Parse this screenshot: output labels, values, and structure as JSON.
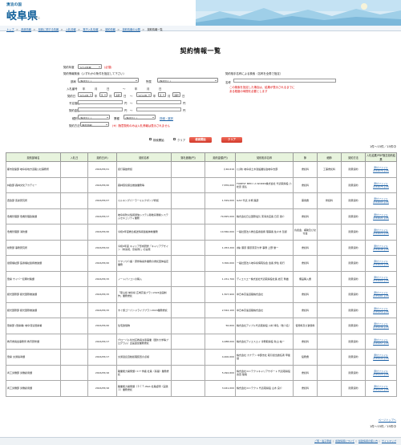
{
  "header": {
    "logo_small": "清流の国",
    "logo_main": "岐阜県",
    "logo_mark": "ぎふ"
  },
  "breadcrumbs": [
    {
      "label": "トップ"
    },
    {
      "label": "県政情報"
    },
    {
      "label": "県政に関する情報"
    },
    {
      "label": "入札情報"
    },
    {
      "label": "電子入札情報"
    },
    {
      "label": "契約情報"
    },
    {
      "label": "契約情報の公開"
    }
  ],
  "breadcrumbs_current": "契約情報一覧",
  "page_title": "契約情報一覧",
  "form": {
    "fiscal_year_label": "契約年度",
    "fiscal_year_value": "2024年度",
    "fiscal_year_req": "(必須)",
    "conditions_label": "契約情報検索（いずれかの条件を指定して下さい）",
    "dept_label": "部局",
    "dept_value": "(指定なし)",
    "bureau_label": "所属",
    "bureau_value": "(指定なし)",
    "contract_no_label": "入札番号",
    "from_label": "年",
    "month_label": "月",
    "day_label": "日",
    "date_label": "契約日",
    "date_from": [
      "2024年",
      "5",
      "14"
    ],
    "date_to": [
      "2024年",
      "5",
      "28"
    ],
    "tilde": "〜",
    "amount_label": "予定価格",
    "amount_unit": "円",
    "price_label": "契約金額",
    "type_label": "種別",
    "type_value": "(指定なし)",
    "business_label": "業種",
    "business_value": "(指定なし)",
    "business_link": "詳細・選択",
    "method_label": "契約方法",
    "method_value": "随意契約",
    "method_note": "(※）随意契約のみは入札情報は表示されません",
    "supplier_label": "契約相手名称による検索（名称を全角で指定）",
    "supplier_name_label": "名称",
    "supplier_note_1": "この検索を指定した場合は、結果が表示されるまでに",
    "supplier_note_2": "ある程度の時間を必要とします",
    "search_hint_label": "検索開始",
    "checkbox_label": "クリア",
    "search_button": "検索開始",
    "clear_button": "クリア"
  },
  "count_text": "1件～15件／15件中",
  "table": {
    "headers": [
      "契約部局名",
      "入札日",
      "契約日(R)",
      "契約名称",
      "落札価格(円)",
      "契約金額(円)",
      "契約相手名称",
      "節",
      "細節",
      "契約方法",
      "入札結果/PDF随意契約結果"
    ],
    "rows": [
      [
        "都市建築部 岐阜県地方道路公社事務所",
        "",
        "2024/05/21",
        "街灯事故修繕",
        "",
        "￥46,616",
        "(公財) 岐阜県土木建設業協会岐阜支部",
        "委託料",
        "工事委託料",
        "随意契約",
        "添付ファイル(K34070.pdf)"
      ],
      [
        "林政部 森林文化アカデミー",
        "",
        "2024/05/20",
        "森林環境保全推進業務等",
        "",
        "7,876,000",
        "FOREST MED I A WORKS株式会社 代表取締役 小松原 康弘",
        "委託料",
        "",
        "随意契約",
        "添付ファイル(K34075.pdf)"
      ],
      [
        "農政部 畜産研究所",
        "",
        "2024/05/27",
        "ミルキングパーラーミルクポンプ修繕",
        "",
        "1,529,000",
        "GAO 代表 片桐 森彦",
        "需用費",
        "修繕料",
        "随意契約",
        "添付ファイル(K34093.pdf)"
      ],
      [
        "危機管理部 危機管理政策課",
        "",
        "2024/05/17",
        "岐阜県防災情報通信システム移動系無線システムセキュリティ業務",
        "",
        "79,825,000",
        "株式会社日立国際電気 東海支店長 日高 啓介",
        "委託料",
        "",
        "随意契約",
        "添付ファイル(K34021.pdf)"
      ],
      [
        "危機管理部 消防課",
        "",
        "2024/05/20",
        "令和6年度救急搬送情報連絡体制業務",
        "",
        "10,560,000",
        "一般社団法人救急医療連携 理事長 佐々木 哲郎",
        "負担金、補助及び交付金",
        "",
        "随意契約",
        "添付ファイル(K34024.pdf)"
      ],
      [
        "総務部 事務研究所",
        "",
        "2024/05/22",
        "令和6年度 キャリア形成研修「キャリアデザイン（未来視、京案例）」の実施",
        "",
        "1,053,200",
        "(株) 藤原 藤原東京大学 事務 上野 優一",
        "委託料",
        "",
        "随意契約",
        "添付ファイル(K34048.pdf)"
      ],
      [
        "健康福祉部 医療福祉連携推進課",
        "",
        "2024/05/20",
        "ケヤリワ介護・研修等案件業務の委託団体設定業務",
        "",
        "3,300,000",
        "一般社団法人岐阜県病院協会 会長 伊住 和行",
        "委託料",
        "",
        "随意契約",
        "添付ファイル(K34029.pdf)"
      ],
      [
        "警察 サイバー犯罪対策課",
        "",
        "2024/05/15",
        "ノートパソコンの購入",
        "",
        "1,151,700",
        "ディエスエー株式会社代表取締役社長 岩元 繁雄",
        "備品購入費",
        "",
        "随意契約",
        "添付ファイル(K34069.pdf)"
      ],
      [
        "観光国際部 観光国際推進課",
        "",
        "2024/05/15",
        "「夏山県 岐阜県 広域高速プラン2024企画制作」業務委託",
        "",
        "1,507,900",
        "中日本高速道路株式会社",
        "委託料",
        "",
        "随意契約",
        "添付ファイル(K35061.pdf)"
      ],
      [
        "観光国際部 観光国際推進課",
        "",
        "2024/05/15",
        "すぐ旅ゴーパンドライブプラン2024業務委託",
        "",
        "2,542,100",
        "中日本高速道路株式会社",
        "委託料",
        "",
        "随意契約",
        "添付ファイル(K35059.pdf)"
      ],
      [
        "警察部 (警察署) 岐阜羽島警察署",
        "",
        "2024/05/20",
        "住宅賃借物",
        "",
        "56,600",
        "株式会社アイブル代表取締役 川村 幸弘（他１名）",
        "使用料及び賃借料",
        "",
        "随意契約",
        "添付ファイル(K35036.pdf)"
      ],
      [
        "教育委員会事務局 教育研修課",
        "",
        "2024/05/17",
        "グローバル化対応教員派遣事業（国外大学等プログラム）企画運営業務委託",
        "",
        "4,488,000",
        "株式会社アイエスエイ 専務取締役 秋山 祐一",
        "委託料",
        "",
        "随意契約",
        "添付ファイル(K35057.pdf)"
      ],
      [
        "警察 交通指導課",
        "",
        "2024/05/17",
        "交通違反自動処理装置の点検",
        "",
        "4,400,000",
        "株式会社 カナデン 中部支社 取引担当責任者 甲斐 健",
        "役務費",
        "",
        "随意契約",
        "添付ファイル(K35044.pdf)"
      ],
      [
        "商工労働部 労働雇用課",
        "",
        "2024/05/16",
        "職業能力開発課 I C T 学識 社員（基礎）業務委託",
        "",
        "5,092,600",
        "株式会社ユニテクトキャリアサポート 代表取締役 吉田 陸哉",
        "委託料",
        "",
        "随意契約",
        "添付ファイル(K35223.pdf)"
      ],
      [
        "商工労働部 労働雇用課",
        "",
        "2024/05/16",
        "職業能力開発課（ＩＣＴ-Web 社員証明（実践１）業務委託",
        "",
        "3,441,000",
        "株式会社ユニテクト 代表取締役 山木 良介",
        "委託料",
        "",
        "随意契約",
        "添付ファイル(K35225.pdf)"
      ]
    ]
  },
  "pagetop": "ページトップへ",
  "footer_links": [
    "ご覧・電子申請",
    "県政情報について",
    "県政情報の使い方",
    "サイトマップ"
  ]
}
